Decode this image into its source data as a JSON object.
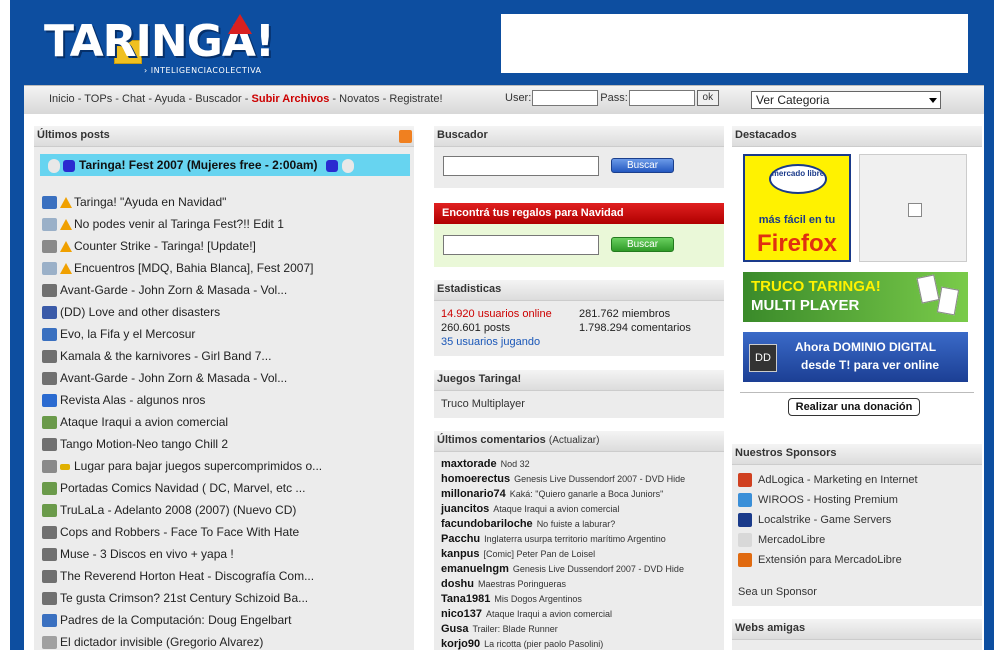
{
  "header": {
    "logo_text": "TARINGA!",
    "logo_sub": "› INTELIGENCIACOLECTIVA"
  },
  "nav": {
    "links": [
      "Inicio",
      "TOPs",
      "Chat",
      "Ayuda",
      "Buscador",
      "Subir Archivos",
      "Novatos",
      "Registrate!"
    ],
    "user_label": "User:",
    "pass_label": "Pass:",
    "ok_label": "ok",
    "category_select": "Ver Categoria"
  },
  "posts": {
    "title": "Últimos posts",
    "sticky": "Taringa! Fest 2007 (Mujeres free - 2:00am)",
    "items": [
      {
        "icon": "book-icon",
        "warn": true,
        "text": "Taringa! \"Ayuda en Navidad\""
      },
      {
        "icon": "chat-icon",
        "warn": true,
        "text": "No podes venir al Taringa Fest?!! Edit 1"
      },
      {
        "icon": "gamepad-icon",
        "warn": true,
        "text": "Counter Strike - Taringa! [Update!]"
      },
      {
        "icon": "chat-icon",
        "warn": true,
        "text": "Encuentros [MDQ, Bahia Blanca], Fest 2007]"
      },
      {
        "icon": "music-icon",
        "warn": false,
        "text": "Avant-Garde - John Zorn & Masada - Vol..."
      },
      {
        "icon": "tv-icon",
        "warn": false,
        "text": "(DD) Love and other disasters"
      },
      {
        "icon": "book-icon",
        "warn": false,
        "text": "Evo, la Fifa y el Mercosur"
      },
      {
        "icon": "music-icon",
        "warn": false,
        "text": "Kamala & the karnivores - Girl Band 7..."
      },
      {
        "icon": "music-icon",
        "warn": false,
        "text": "Avant-Garde - John Zorn & Masada - Vol..."
      },
      {
        "icon": "floppy-icon",
        "warn": false,
        "text": "Revista Alas - algunos nros"
      },
      {
        "icon": "image-icon",
        "warn": false,
        "text": "Ataque Iraqui a avion comercial"
      },
      {
        "icon": "music-icon",
        "warn": false,
        "text": "Tango Motion-Neo tango Chill 2"
      },
      {
        "icon": "gamepad-icon",
        "warn": false,
        "key": true,
        "text": "Lugar para bajar juegos supercomprimidos o..."
      },
      {
        "icon": "image-icon",
        "warn": false,
        "text": "Portadas Comics Navidad ( DC, Marvel, etc ..."
      },
      {
        "icon": "image-icon",
        "warn": false,
        "text": "TruLaLa - Adelanto 2008 (2007) (Nuevo CD)"
      },
      {
        "icon": "music-icon",
        "warn": false,
        "text": "Cops and Robbers - Face To Face With Hate"
      },
      {
        "icon": "music-icon",
        "warn": false,
        "text": "Muse - 3 Discos en vivo + yapa !"
      },
      {
        "icon": "music-icon",
        "warn": false,
        "text": "The Reverend Horton Heat - Discografía Com..."
      },
      {
        "icon": "music-icon",
        "warn": false,
        "text": "Te gusta Crimson? 21st Century Schizoid Ba..."
      },
      {
        "icon": "book-icon",
        "warn": false,
        "text": "Padres de la Computación: Doug Engelbart"
      },
      {
        "icon": "tag-icon",
        "warn": false,
        "text": "El dictador invisible (Gregorio Alvarez)"
      }
    ]
  },
  "search": {
    "title": "Buscador",
    "button": "Buscar"
  },
  "gifts": {
    "title": "Encontrá tus regalos para Navidad",
    "button": "Buscar"
  },
  "stats": {
    "title": "Estadisticas",
    "online": "14.920 usuarios online",
    "members": "281.762 miembros",
    "posts": "260.601 posts",
    "comments": "1.798.294 comentarios",
    "playing": "35 usuarios jugando"
  },
  "games": {
    "title": "Juegos Taringa!",
    "item": "Truco Multiplayer"
  },
  "comments": {
    "title": "Últimos comentarios",
    "update": "(Actualizar)",
    "items": [
      {
        "user": "maxtorade",
        "text": "Nod 32"
      },
      {
        "user": "homoerectus",
        "text": "Genesis Live Dussendorf 2007 - DVD Hide"
      },
      {
        "user": "millonario74",
        "text": "Kaká: \"Quiero ganarle a Boca Juniors\""
      },
      {
        "user": "juancitos",
        "text": "Ataque Iraqui a avion comercial"
      },
      {
        "user": "facundobariloche",
        "text": "No fuiste a laburar?"
      },
      {
        "user": "Pacchu",
        "text": "Inglaterra usurpa territorio marítimo Argentino"
      },
      {
        "user": "kanpus",
        "text": "[Comic] Peter Pan de Loisel"
      },
      {
        "user": "emanuelngm",
        "text": "Genesis Live Dussendorf 2007 - DVD Hide"
      },
      {
        "user": "doshu",
        "text": "Maestras Poringueras"
      },
      {
        "user": "Tana1981",
        "text": "Mis Dogos Argentinos"
      },
      {
        "user": "nico137",
        "text": "Ataque Iraqui a avion comercial"
      },
      {
        "user": "Gusa",
        "text": "Trailer: Blade Runner"
      },
      {
        "user": "korjo90",
        "text": "La ricotta (pier paolo Pasolini)"
      }
    ]
  },
  "featured": {
    "title": "Destacados",
    "ml_logo": "mercado libre",
    "ml_line1": "más fácil en tu",
    "ml_line2": "Firefox",
    "truco_line1": "TRUCO TARINGA!",
    "truco_line2": "MULTI PLAYER",
    "dd_badge": "DD",
    "dd_line1": "Ahora DOMINIO DIGITAL",
    "dd_line2": "desde T! para ver online",
    "donate": "Realizar una donación"
  },
  "sponsors": {
    "title": "Nuestros Sponsors",
    "items": [
      {
        "icon": "adlogica-icon",
        "color": "#d04020",
        "text": "AdLogica - Marketing en Internet"
      },
      {
        "icon": "wiroos-icon",
        "color": "#3a8fd8",
        "text": "WIROOS - Hosting Premium"
      },
      {
        "icon": "localstrike-icon",
        "color": "#1a3a8a",
        "text": "Localstrike - Game Servers"
      },
      {
        "icon": "mercadolibre-icon",
        "color": "#d8d8d8",
        "text": "MercadoLibre"
      },
      {
        "icon": "firefox-icon",
        "color": "#e06a10",
        "text": "Extensión para MercadoLibre"
      }
    ],
    "footer": "Sea un Sponsor"
  },
  "friends": {
    "title": "Webs amigas"
  }
}
